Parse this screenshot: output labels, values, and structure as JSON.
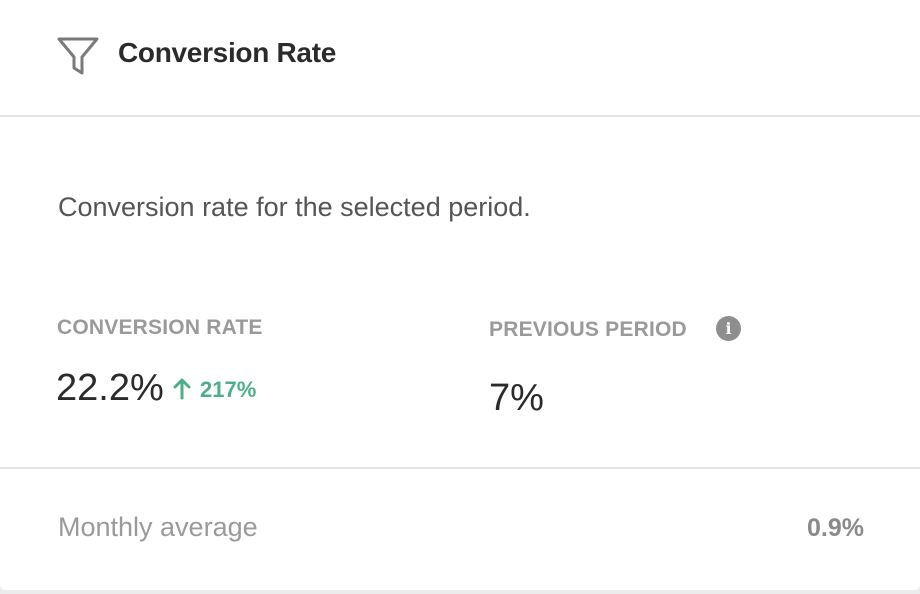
{
  "widget": {
    "title": "Conversion Rate",
    "icon": "funnel-icon",
    "description": "Conversion rate for the selected period."
  },
  "current": {
    "label": "CONVERSION RATE",
    "value": "22.2%",
    "change": "217%",
    "change_direction": "up",
    "change_color": "#4caf8a"
  },
  "previous": {
    "label": "PREVIOUS PERIOD",
    "value": "7%",
    "info_icon": "info-icon"
  },
  "footer": {
    "label": "Monthly average",
    "value": "0.9%"
  }
}
